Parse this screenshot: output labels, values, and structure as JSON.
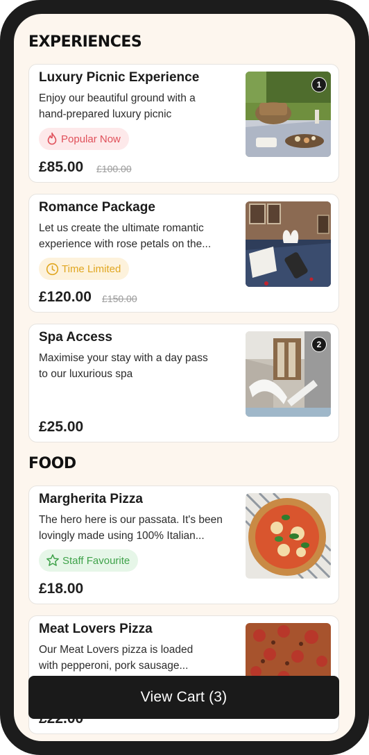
{
  "sections": [
    {
      "title": "EXPERIENCES",
      "items": [
        {
          "title": "Luxury Picnic Experience",
          "desc_line1": "Enjoy our beautiful ground with a",
          "desc_line2": "hand-prepared luxury picnic",
          "badge": "Popular Now",
          "badge_icon": "flame-icon",
          "price": "£85.00",
          "old_price": "£100.00",
          "cart_count": "1"
        },
        {
          "title": "Romance Package",
          "desc_line1": "Let us create the ultimate romantic",
          "desc_line2": "experience with rose petals on the...",
          "badge": "Time Limited",
          "badge_icon": "clock-icon",
          "price": "£120.00",
          "old_price": "£150.00"
        },
        {
          "title": "Spa Access",
          "desc_line1": "Maximise your stay with a day pass",
          "desc_line2": "to our luxurious spa",
          "price": "£25.00",
          "cart_count": "2"
        }
      ]
    },
    {
      "title": "FOOD",
      "items": [
        {
          "title": "Margherita Pizza",
          "desc_line1": "The hero here is our passata. It's been",
          "desc_line2": "lovingly made using 100% Italian...",
          "badge": "Staff Favourite",
          "badge_icon": "star-icon",
          "price": "£18.00"
        },
        {
          "title": "Meat Lovers Pizza",
          "desc_line1": "Our Meat Lovers pizza is loaded",
          "desc_line2": "with pepperoni, pork sausage...",
          "price": "£22.00"
        }
      ]
    }
  ],
  "cart": {
    "label": "View Cart (3)"
  },
  "colors": {
    "background": "#fdf6ee",
    "badge_popular": "#e0505a",
    "badge_limited": "#e0a620",
    "badge_favourite": "#3fa24a",
    "button": "#1a1a1a"
  }
}
